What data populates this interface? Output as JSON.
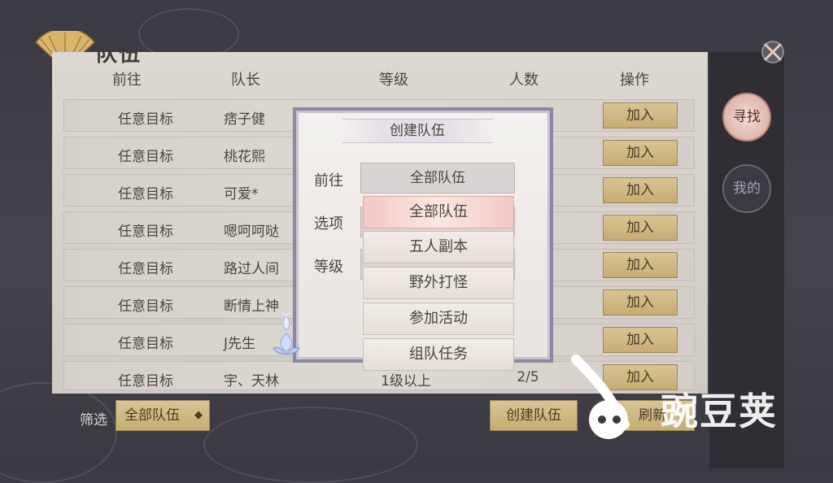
{
  "panel": {
    "title": "队伍"
  },
  "table": {
    "headers": [
      "前往",
      "队长",
      "等级",
      "人数",
      "操作"
    ],
    "rows": [
      {
        "dest": "任意目标",
        "leader": "痞子健",
        "level": "",
        "count": "",
        "action": "加入"
      },
      {
        "dest": "任意目标",
        "leader": "桃花熙",
        "level": "",
        "count": "",
        "action": "加入"
      },
      {
        "dest": "任意目标",
        "leader": "可爱*",
        "level": "",
        "count": "",
        "action": "加入"
      },
      {
        "dest": "任意目标",
        "leader": "嗯呵呵哒",
        "level": "",
        "count": "",
        "action": "加入"
      },
      {
        "dest": "任意目标",
        "leader": "路过人间",
        "level": "",
        "count": "",
        "action": "加入"
      },
      {
        "dest": "任意目标",
        "leader": "断情上神",
        "level": "",
        "count": "",
        "action": "加入"
      },
      {
        "dest": "任意目标",
        "leader": "J先生",
        "level": "",
        "count": "",
        "action": "加入"
      },
      {
        "dest": "任意目标",
        "leader": "宇、天林",
        "level": "1级以上",
        "count": "2/5",
        "action": "加入"
      }
    ]
  },
  "sidebar": {
    "find_label": "寻找",
    "mine_label": "我的"
  },
  "footer": {
    "filter_label": "筛选",
    "filter_value": "全部队伍",
    "create_label": "创建队伍",
    "refresh_label": "刷新"
  },
  "dialog": {
    "title": "创建队伍",
    "dest_label": "前往",
    "dest_value": "全部队伍",
    "option_label": "选项",
    "level_label": "等级",
    "dropdown_options": [
      "全部队伍",
      "五人副本",
      "野外打怪",
      "参加活动",
      "组队任务"
    ],
    "selected_index": 0
  },
  "watermark": {
    "text": "豌豆荚"
  },
  "colors": {
    "accent_gold": "#c6ad73",
    "selected_pink": "#f3c9c4",
    "dialog_border": "#8f86a0"
  }
}
